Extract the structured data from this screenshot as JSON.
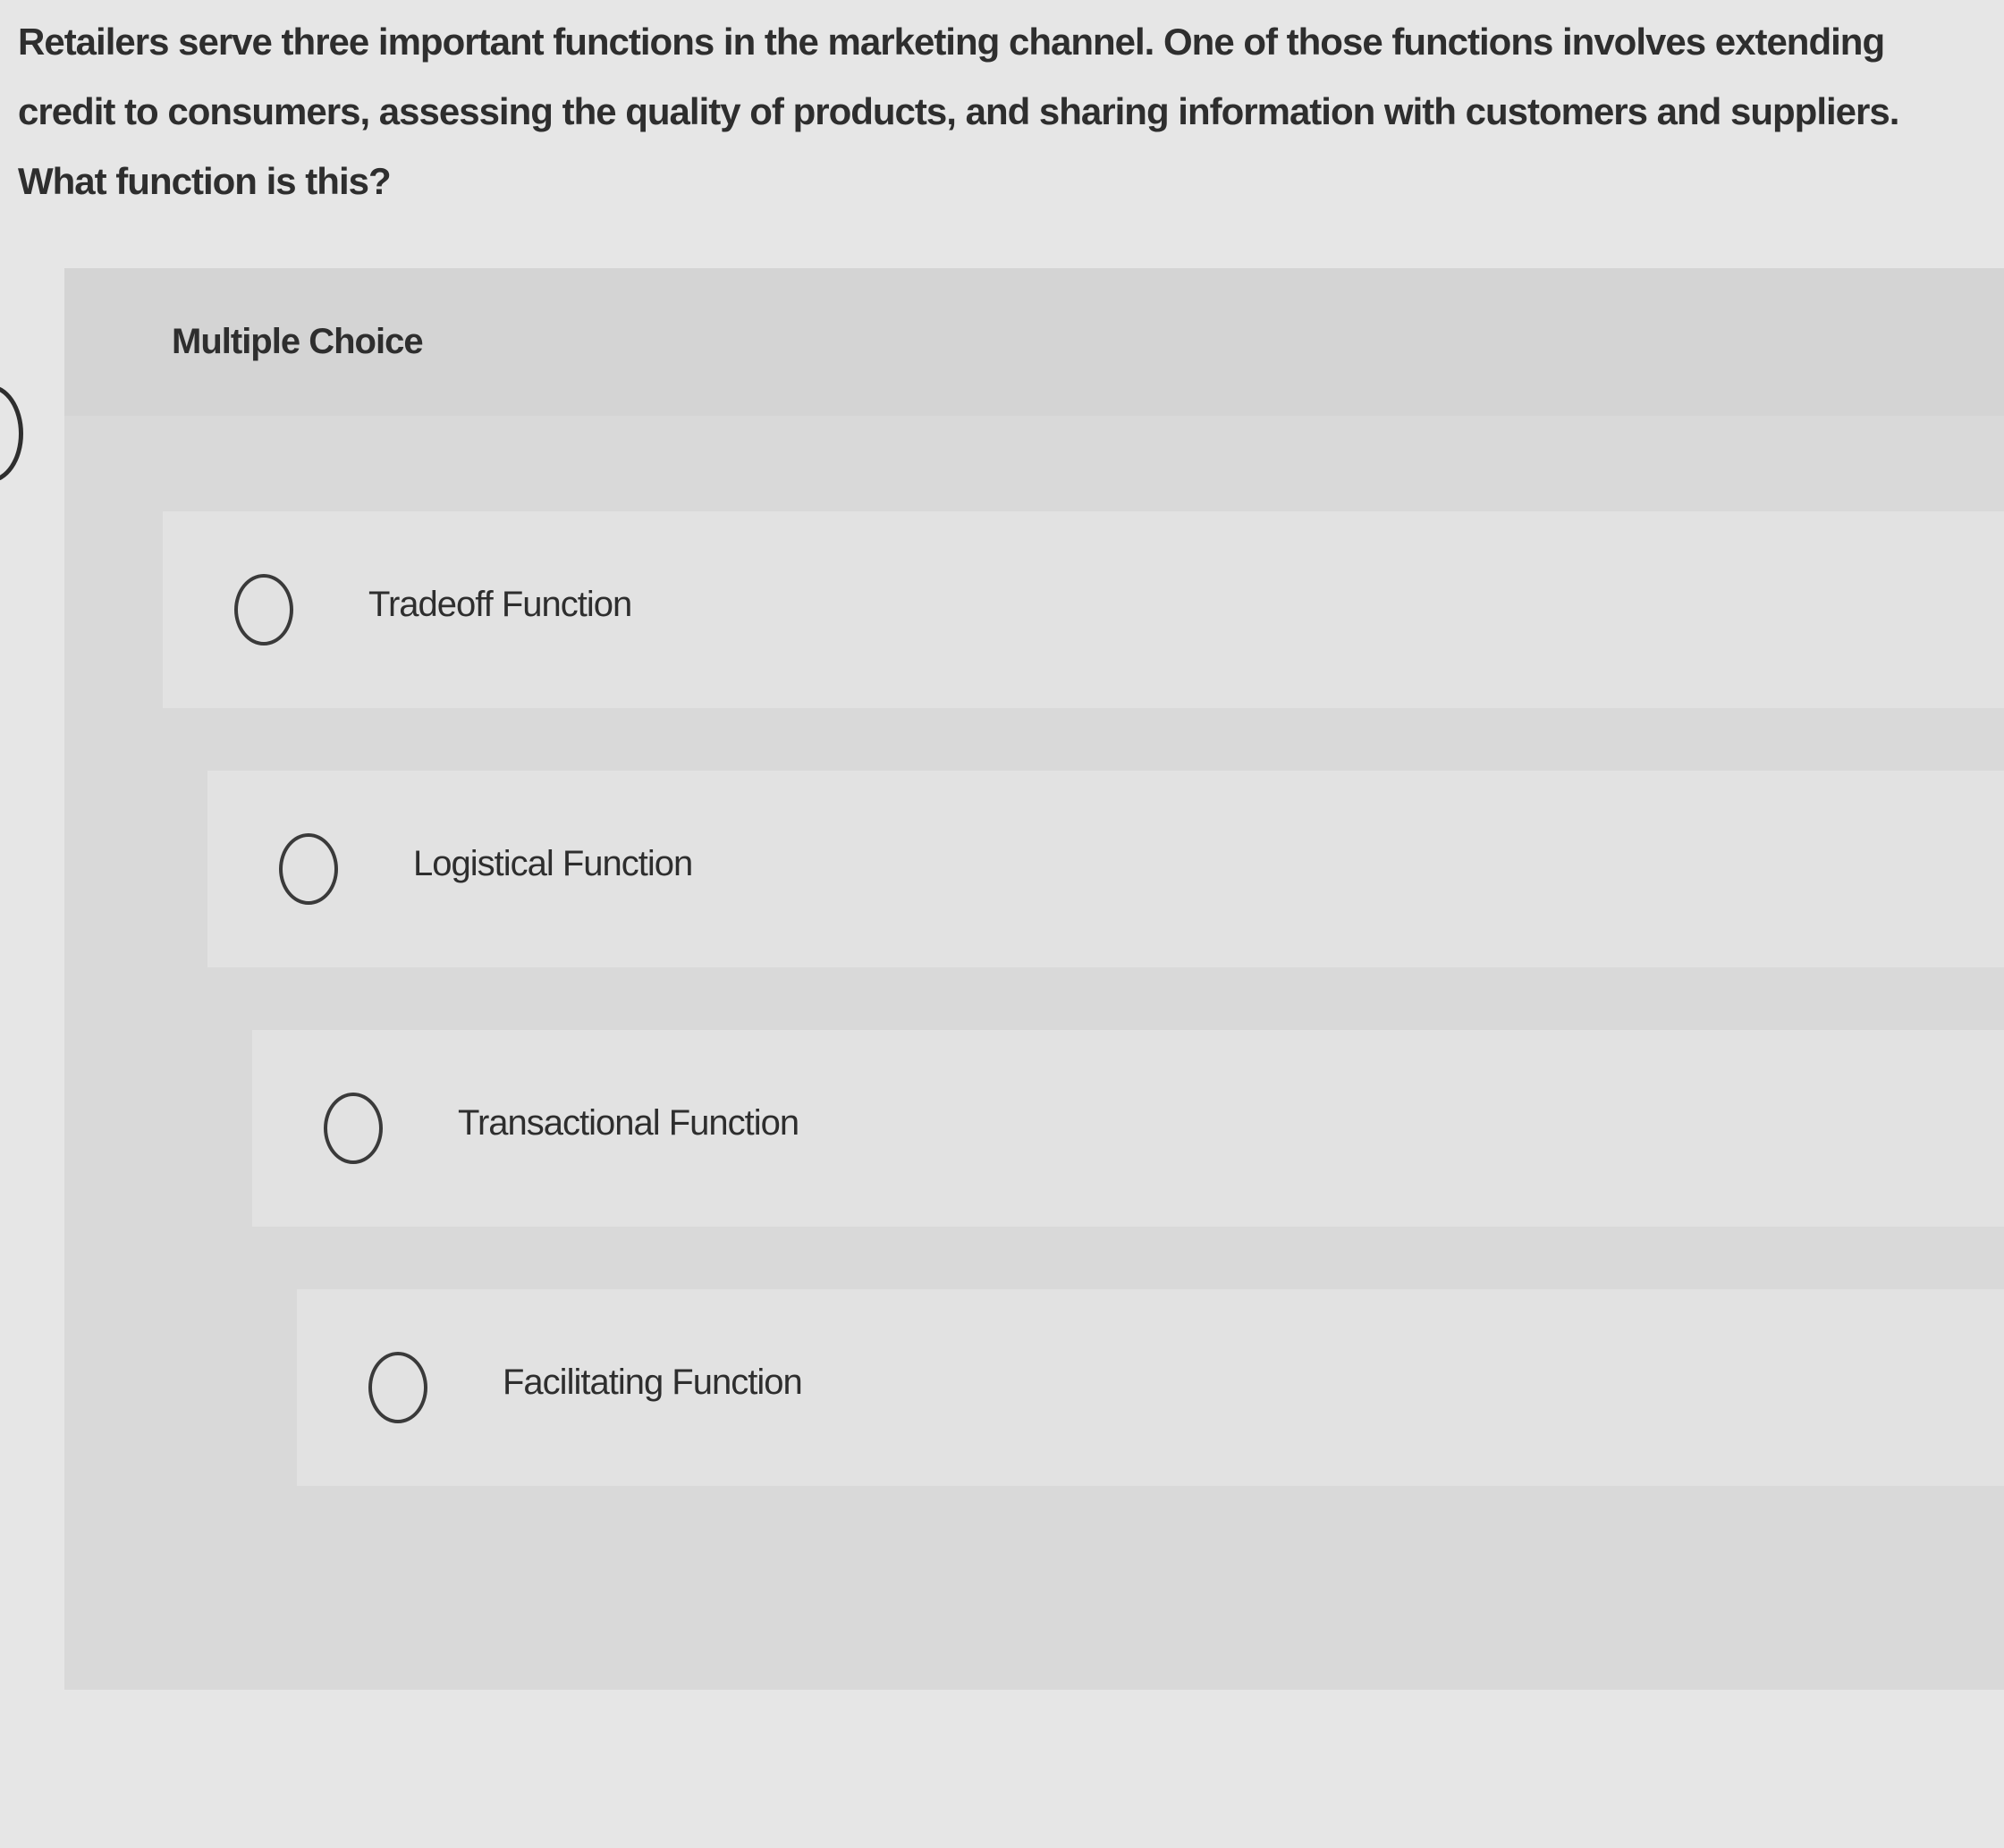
{
  "question": {
    "text": "Retailers serve three important functions in the marketing channel. One of those functions involves extending credit to consumers, assessing the quality of products, and sharing information with customers and suppliers. What function is this?"
  },
  "panel": {
    "label": "Multiple Choice"
  },
  "options": [
    {
      "label": "Tradeoff Function"
    },
    {
      "label": "Logistical Function"
    },
    {
      "label": "Transactional Function"
    },
    {
      "label": "Facilitating Function"
    }
  ],
  "colors": {
    "page_background": "#e6e6e6",
    "panel_background": "#d9d9d9",
    "option_background": "#e2e2e2",
    "text": "#2e2e2e"
  },
  "icons": {
    "radio": "radio-unselected-icon",
    "edge": "partial-circle-icon"
  }
}
